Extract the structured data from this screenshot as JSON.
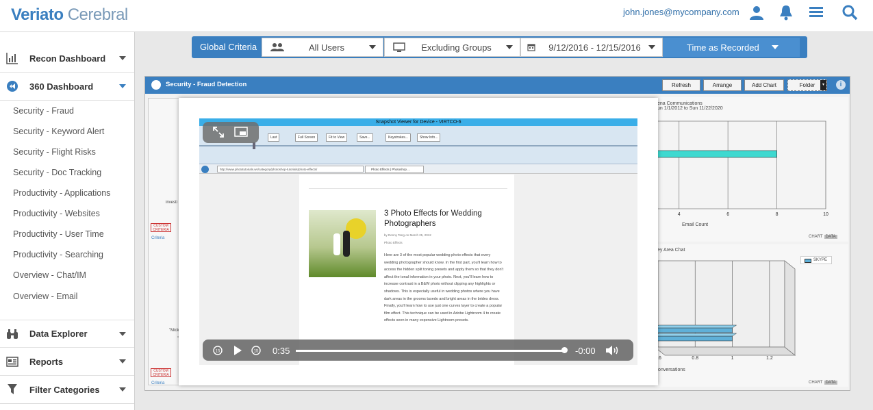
{
  "header": {
    "logo_brand": "Veriato",
    "logo_product": "Cerebral",
    "user_email": "john.jones@mycompany.com"
  },
  "sidebar": {
    "main": [
      {
        "label": "Recon Dashboard",
        "icon": "recon-dashboard-icon"
      },
      {
        "label": "360 Dashboard",
        "icon": "360-dashboard-icon"
      }
    ],
    "sub_items": [
      "Security - Fraud",
      "Security - Keyword Alert",
      "Security - Flight Risks",
      "Security - Doc Tracking",
      "Productivity - Applications",
      "Productivity - Websites",
      "Productivity - User Time",
      "Productivity - Searching",
      "Overview - Chat/IM",
      "Overview - Email"
    ],
    "bottom": [
      {
        "label": "Data Explorer",
        "icon": "binoculars-icon"
      },
      {
        "label": "Reports",
        "icon": "reports-icon"
      },
      {
        "label": "Filter Categories",
        "icon": "filter-icon"
      }
    ]
  },
  "criteria": {
    "label": "Global Criteria",
    "users": "All Users",
    "groups": "Excluding Groups",
    "dates": "9/12/2016 - 12/15/2016",
    "time": "Time as Recorded"
  },
  "panel": {
    "title": "Security - Fraud Detection",
    "buttons": {
      "refresh": "Refresh",
      "arrange": "Arrange",
      "add_chart": "Add Chart",
      "folder": "Folder"
    },
    "info": "i"
  },
  "left_col": {
    "text_a": "investi",
    "text_b": "\"Mick",
    "text_c": "\"T",
    "custom": "CUSTOM CRITERIA",
    "criteria_link": "Criteria"
  },
  "chart1": {
    "title_line1": "ena Communications",
    "title_line2": "un 1/1/2012 to Sun 11/22/2020",
    "xlabel": "Email Count",
    "tab_chart": "CHART",
    "tab_data": "DATA"
  },
  "chart2": {
    "title": "ey Area Chat",
    "legend": "SKYPE",
    "xlabel": "Conversations",
    "tab_chart": "CHART",
    "tab_data": "DATA"
  },
  "chart_data": [
    {
      "type": "bar",
      "title": "",
      "xlabel": "Email Count",
      "x_ticks": [
        "4",
        "6",
        "8",
        "10"
      ],
      "series": [
        {
          "values": [
            8.0,
            3.0
          ]
        }
      ],
      "colors": [
        "#3ed9d0",
        "#8bc34a"
      ],
      "xlim": [
        3,
        10
      ]
    },
    {
      "type": "bar",
      "title": "",
      "xlabel": "Conversations",
      "x_ticks": [
        "0.6",
        "0.8",
        "1",
        "1.2"
      ],
      "series": [
        {
          "name": "SKYPE",
          "values": [
            1.0,
            1.0
          ]
        }
      ],
      "colors": [
        "#5fb0d8"
      ],
      "xlim": [
        0.6,
        1.3
      ]
    }
  ],
  "viewer": {
    "title": "Snapshot Viewer for Device - VIRTCO-6",
    "toolbar": [
      "Last",
      "Full Screen",
      "Fit to View",
      "Save...",
      "Keystrokes...",
      "Show Info..."
    ],
    "url": "http://www.phototutorials.ws/category/photoshop-tutorials/photo-effects/",
    "tab": "Photo Effects | Photoshop ...",
    "article_title": "3 Photo Effects for Wedding Photographers",
    "byline": "by Denny Tang on March 25, 2012",
    "category": "Photo Effects",
    "body": "Here are 3 of the most popular wedding photo effects that every wedding photographer should know. In the first part, you'll learn how to access the hidden split toning presets and apply them so that they don't affect the tonal information in your photo. Next, you'll learn how to increase contrast in a B&W photo without clipping any highlights or shadows. This is especially useful in wedding photos where you have dark areas in the grooms tuxedo and bright areas in the brides dress. Finally, you'll learn how to use just one curves layer to create a popular film effect. This technique can be used in Adobe Lightroom 4 to create effects seen in many expensive Lightroom presets.",
    "time_elapsed": "0:35",
    "time_remaining": "-0:00",
    "progress": 0.99
  }
}
